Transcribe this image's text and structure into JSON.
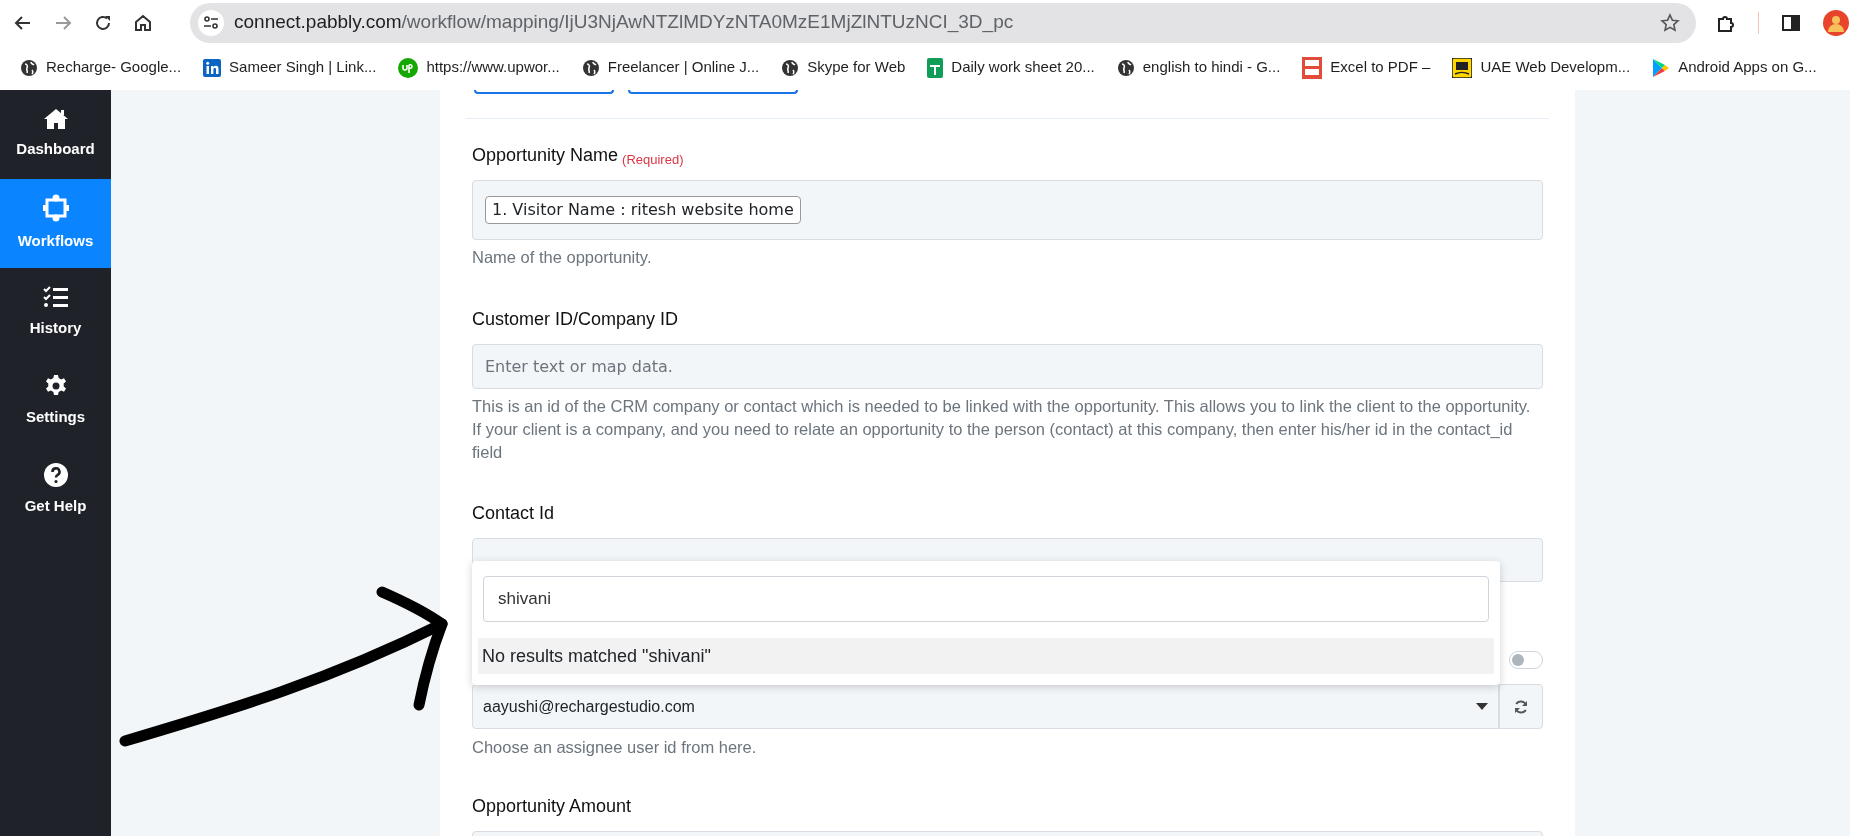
{
  "browser": {
    "url_host": "connect.pabbly.com",
    "url_path": "/workflow/mapping/IjU3NjAwNTZlMDYzNTA0MzE1MjZlNTUzNCI_3D_pc"
  },
  "bookmarks": [
    {
      "label": "Recharge- Google...",
      "kind": "globe"
    },
    {
      "label": "Sameer Singh | Link...",
      "kind": "linkedin"
    },
    {
      "label": "https://www.upwor...",
      "kind": "upwork"
    },
    {
      "label": "Freelancer | Online J...",
      "kind": "globe"
    },
    {
      "label": "Skype for Web",
      "kind": "globe"
    },
    {
      "label": "Daily work sheet 20...",
      "kind": "sheet"
    },
    {
      "label": "english to hindi - G...",
      "kind": "globe"
    },
    {
      "label": "Excel to PDF –",
      "kind": "pdf"
    },
    {
      "label": "UAE Web Developm...",
      "kind": "yp"
    },
    {
      "label": "Android Apps on G...",
      "kind": "play"
    }
  ],
  "sidebar": {
    "items": [
      {
        "label": "Dashboard",
        "kind": "home",
        "selected": false
      },
      {
        "label": "Workflows",
        "kind": "workflow",
        "selected": true
      },
      {
        "label": "History",
        "kind": "history",
        "selected": false
      },
      {
        "label": "Settings",
        "kind": "settings",
        "selected": false
      },
      {
        "label": "Get Help",
        "kind": "help",
        "selected": false
      }
    ]
  },
  "fields": [
    {
      "kind": "token",
      "label": "Opportunity Name",
      "required": "(Required)",
      "token": "1. Visitor Name : ritesh website home",
      "help": "Name of the opportunity."
    },
    {
      "kind": "text",
      "label": "Customer ID/Company ID",
      "placeholder": "Enter text or map data.",
      "help": "This is an id of the CRM company or contact which is needed to be linked with the opportunity. This allows you to link the client to the opportunity. If your client is a company, and you need to relate an opportunity to the person (contact) at this company, then enter his/her id in the contact_id field"
    },
    {
      "kind": "text",
      "label": "Contact Id",
      "dropdown": {
        "search": "shivani",
        "message": "No results matched \"shivani\""
      }
    },
    {
      "kind": "select",
      "value": "aayushi@rechargestudio.com",
      "toggle": {
        "on": false
      },
      "help": "Choose an assignee user id from here."
    },
    {
      "kind": "text",
      "label": "Opportunity Amount"
    }
  ]
}
